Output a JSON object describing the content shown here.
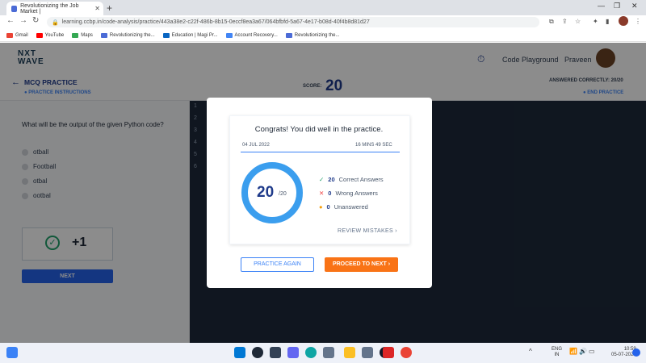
{
  "browser": {
    "tab_title": "Revolutionizing the Job Market |",
    "url": "learning.ccbp.in/code-analysis/practice/443a38e2-c22f-486b-8b15-0eccf8ea3a67/064bfbfd-5a67-4e17-b08d-40f4b8d81d27",
    "bookmarks": [
      "Gmail",
      "YouTube",
      "Maps",
      "Revolutionizing the...",
      "Education | Magi Pr...",
      "Account Recovery...",
      "Revolutionizing the..."
    ]
  },
  "app": {
    "logo_line1": "NXT",
    "logo_line2": "WAVE",
    "code_playground": "Code Playground",
    "user_name": "Praveen"
  },
  "subheader": {
    "title": "MCQ PRACTICE",
    "instructions": "PRACTICE INSTRUCTIONS",
    "score_label": "SCORE:",
    "score_value": "20",
    "answered": "ANSWERED CORRECTLY: 20/20",
    "end_practice": "END PRACTICE"
  },
  "question": {
    "text": "What will be the output of the given Python code?",
    "options": [
      "otball",
      "Football",
      "otbal",
      "ootbal"
    ],
    "result": "+1",
    "next_label": "NEXT"
  },
  "editor": {
    "line_numbers": [
      "1",
      "2",
      "3",
      "4",
      "5",
      "6"
    ]
  },
  "modal": {
    "title": "Congrats! You did well in the practice.",
    "date": "04 JUL 2022",
    "duration": "16 MINS 49 SEC",
    "score": "20",
    "score_total": "/20",
    "correct_count": "20",
    "correct_label": "Correct Answers",
    "wrong_count": "0",
    "wrong_label": "Wrong Answers",
    "unanswered_count": "0",
    "unanswered_label": "Unanswered",
    "review": "REVIEW MISTAKES",
    "practice_again": "PRACTICE AGAIN",
    "proceed": "PROCEED TO NEXT"
  },
  "taskbar": {
    "lang1": "ENG",
    "lang2": "IN",
    "time": "10:59",
    "date": "05-07-2022"
  },
  "colors": {
    "accent": "#1e3a8a",
    "ring": "#3b9eee",
    "proceed": "#f97316",
    "correct": "#22a06b",
    "wrong": "#ef4444",
    "unanswered": "#f59e0b"
  }
}
